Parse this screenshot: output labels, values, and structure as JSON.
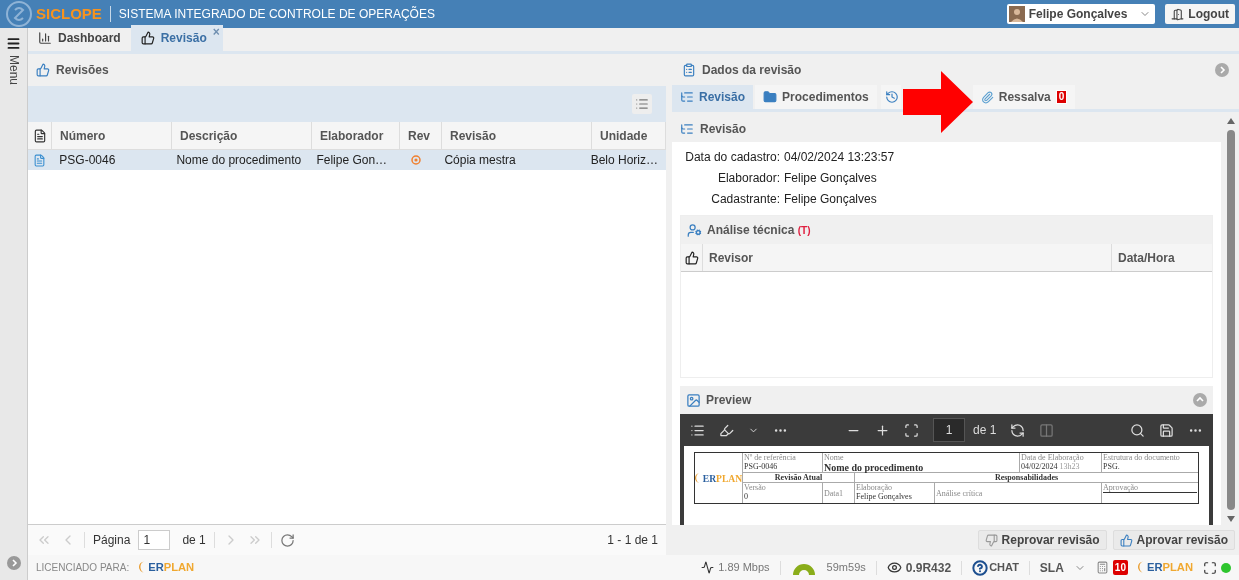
{
  "header": {
    "logo": "SICLOPE",
    "title": "SISTEMA INTEGRADO DE CONTROLE DE OPERAÇÕES",
    "user": "Felipe Gonçalves",
    "logout": "Logout"
  },
  "sidebar": {
    "label": "Menu"
  },
  "tabs": [
    {
      "label": "Dashboard",
      "selected": false
    },
    {
      "label": "Revisão",
      "selected": true,
      "close": "×"
    }
  ],
  "revisions": {
    "title": "Revisões",
    "columns": [
      "Número",
      "Descrição",
      "Elaborador",
      "Rev",
      "Revisão",
      "Unidade"
    ],
    "rows": [
      {
        "selected": true,
        "cells": [
          "PSG-0046",
          "Nome do procedimento",
          "Felipe Gon…",
          "",
          "Cópia mestra",
          "Belo Horiz…"
        ]
      }
    ],
    "pager": {
      "label": "Página",
      "page": "1",
      "of": "de 1",
      "range": "1 - 1 de 1"
    }
  },
  "details": {
    "title": "Dados da revisão",
    "tabs": [
      {
        "label": "Revisão",
        "selected": true
      },
      {
        "label": "Procedimentos",
        "selected": false
      },
      {
        "selected": false
      },
      {
        "label": "Ressalva",
        "selected": false,
        "badge": "0"
      }
    ],
    "section": "Revisão",
    "fields": [
      {
        "label": "Data do cadastro:",
        "value": "04/02/2024 13:23:57"
      },
      {
        "label": "Elaborador:",
        "value": "Felipe Gonçalves"
      },
      {
        "label": "Cadastrante:",
        "value": "Felipe Gonçalves"
      }
    ],
    "analysis": {
      "title": "Análise técnica",
      "flag": "(T)",
      "columns": [
        "Revisor",
        "Data/Hora"
      ]
    },
    "preview": {
      "title": "Preview",
      "page": "1",
      "of": "de 1",
      "document": {
        "brand_a": "ER",
        "brand_b": "PLAN",
        "ref_label": "Nº de referência",
        "ref": "PSG-0046",
        "name_label": "Nome",
        "name": "Nome do procedimento",
        "date_label": "Data de Elaboração",
        "date": "04/02/2024",
        "time": "13h23",
        "structure_label": "Estrutura do documento",
        "structure": "PSG.",
        "current": "Revisão Atual",
        "resp": "Responsabilidades",
        "version_label": "Versão",
        "version": "0",
        "data_label": "Data1",
        "author_label": "Elaboração",
        "author": "Felipe Gonçalves",
        "critical_label": "Análise crítica",
        "approval_label": "Aprovação"
      }
    },
    "buttons": [
      "Reprovar revisão",
      "Aprovar revisão"
    ]
  },
  "footer": {
    "licensed": "LICENCIADO PARA:",
    "license_brand_a": "ER",
    "license_brand_b": "PLAN",
    "brand_a": "ER",
    "brand_b": "PLAN",
    "speed": "1.89 Mbps",
    "timer": "59m59s",
    "version": "0.9R432",
    "chat": "CHAT",
    "sla": "SLA",
    "notifications": "10",
    "online": true
  }
}
